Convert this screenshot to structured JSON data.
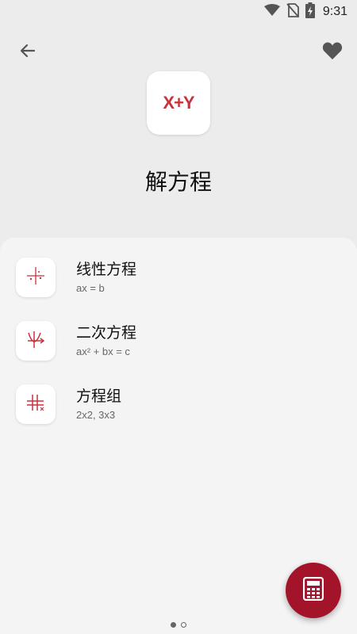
{
  "status_bar": {
    "time": "9:31",
    "icons": [
      "wifi-icon",
      "no-sim-icon",
      "battery-charging-icon"
    ]
  },
  "header": {
    "back_icon": "arrow-back-icon",
    "favorite_icon": "heart-icon",
    "logo_text": "X+Y",
    "title": "解方程"
  },
  "list": {
    "items": [
      {
        "title": "线性方程",
        "subtitle": "ax = b",
        "icon": "linear-equation-icon"
      },
      {
        "title": "二次方程",
        "subtitle": "ax² + bx = c",
        "icon": "quadratic-equation-icon"
      },
      {
        "title": "方程组",
        "subtitle": "2x2, 3x3",
        "icon": "equation-system-icon"
      }
    ]
  },
  "fab": {
    "icon": "calculator-icon"
  },
  "pager": {
    "count": 2,
    "active_index": 0
  },
  "colors": {
    "accent": "#a3142a",
    "icon_red": "#c8323c",
    "background": "#ececec",
    "sheet": "#f4f4f4"
  }
}
